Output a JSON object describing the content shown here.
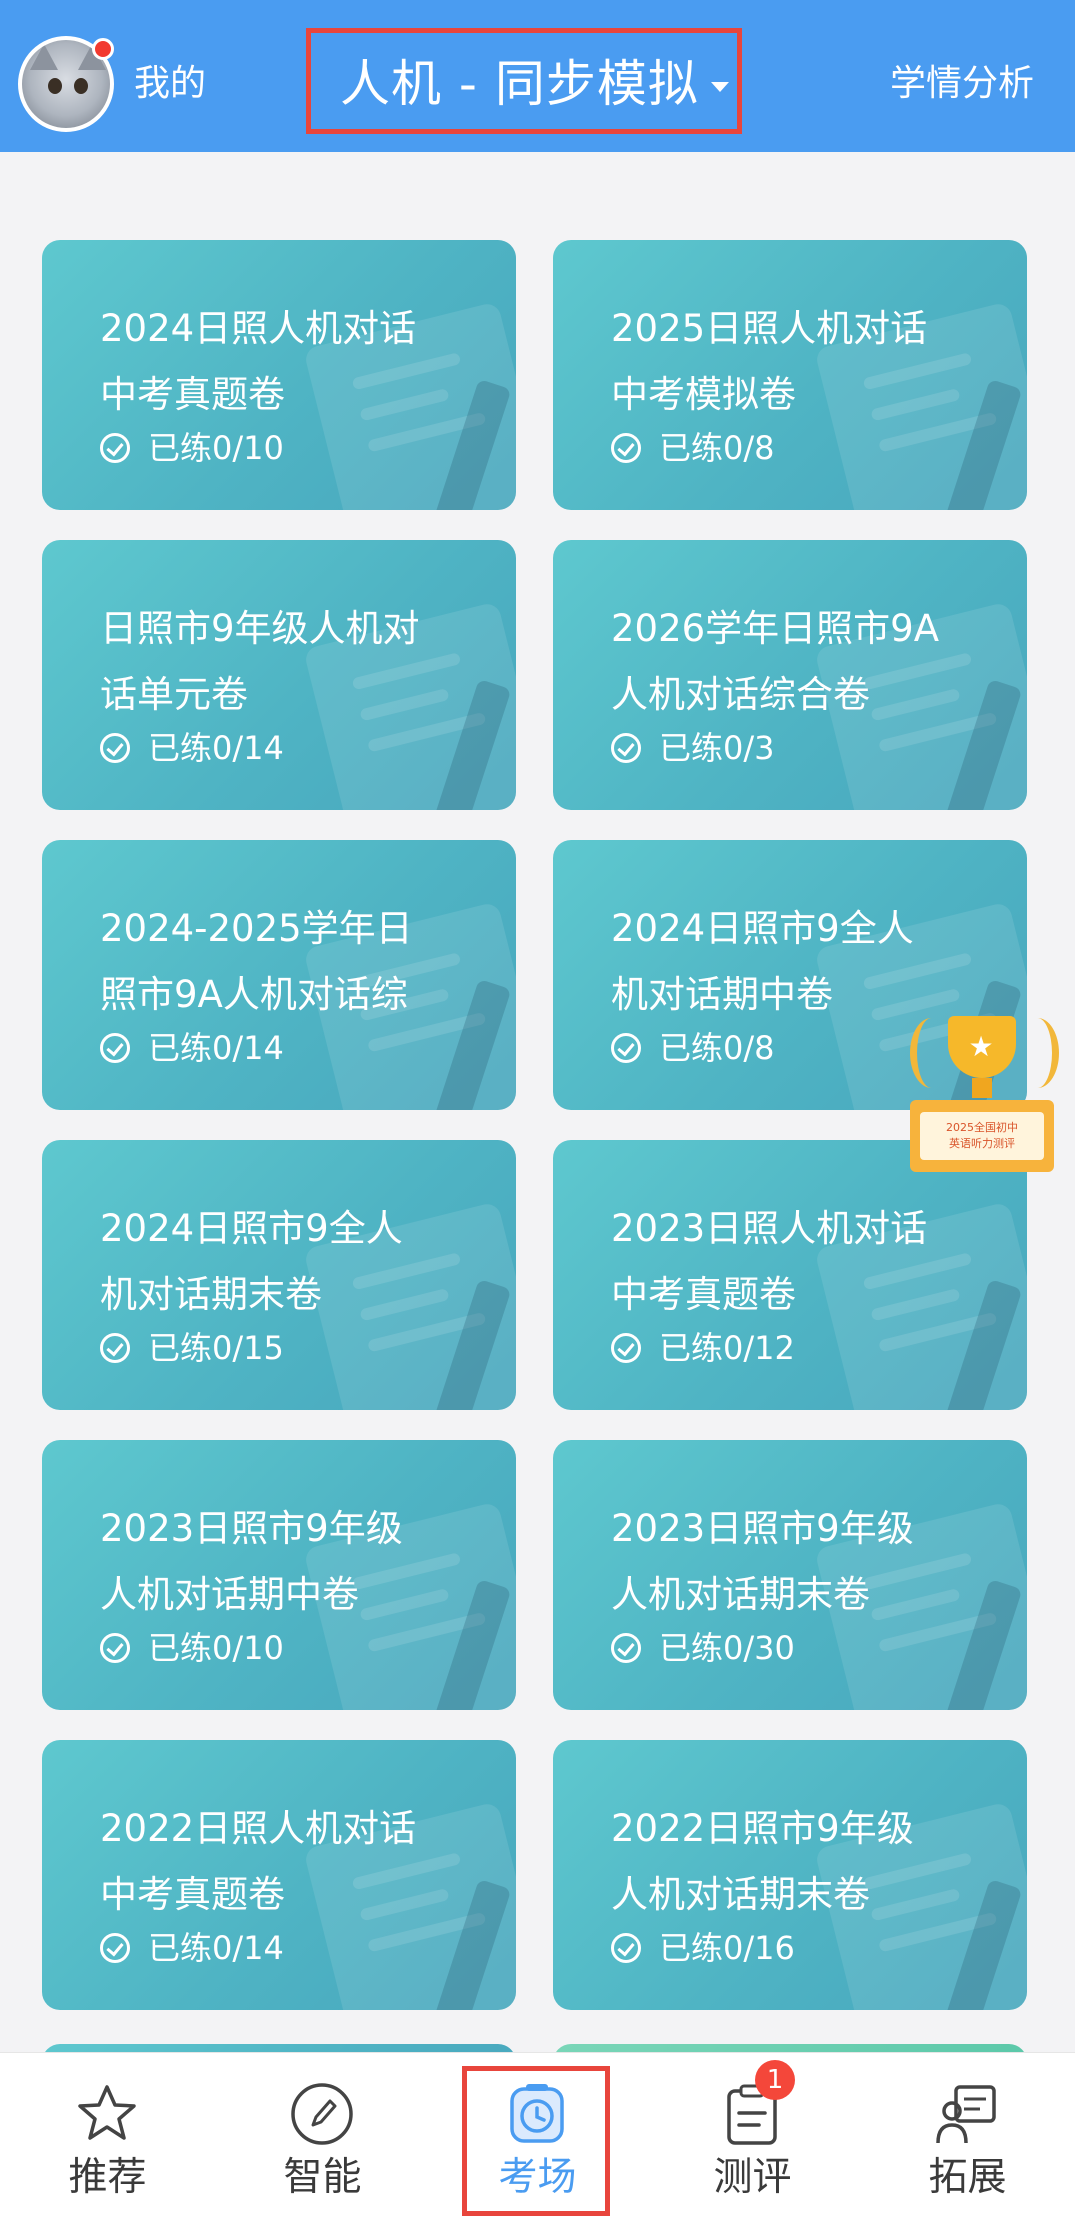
{
  "header": {
    "profile_label": "我的",
    "mode_title": "人机 - 同步模拟",
    "analysis_label": "学情分析"
  },
  "cards": [
    {
      "title": "2024日照人机对话\n中考真题卷",
      "status": "已练0/10"
    },
    {
      "title": "2025日照人机对话\n中考模拟卷",
      "status": "已练0/8"
    },
    {
      "title": "日照市9年级人机对\n话单元卷",
      "status": "已练0/14"
    },
    {
      "title": "2026学年日照市9A\n人机对话综合卷",
      "status": "已练0/3"
    },
    {
      "title": "2024-2025学年日\n照市9A人机对话综",
      "status": "已练0/14"
    },
    {
      "title": "2024日照市9全人\n机对话期中卷",
      "status": "已练0/8"
    },
    {
      "title": "2024日照市9全人\n机对话期末卷",
      "status": "已练0/15"
    },
    {
      "title": "2023日照人机对话\n中考真题卷",
      "status": "已练0/12"
    },
    {
      "title": "2023日照市9年级\n人机对话期中卷",
      "status": "已练0/10"
    },
    {
      "title": "2023日照市9年级\n人机对话期末卷",
      "status": "已练0/30"
    },
    {
      "title": "2022日照人机对话\n中考真题卷",
      "status": "已练0/14"
    },
    {
      "title": "2022日照市9年级\n人机对话期末卷",
      "status": "已练0/16"
    }
  ],
  "promo": {
    "trophy_text": "2025全国初中\n英语听力测评"
  },
  "tabbar": {
    "tabs": [
      {
        "label": "推荐",
        "icon": "star-icon"
      },
      {
        "label": "智能",
        "icon": "pencil-circle-icon"
      },
      {
        "label": "考场",
        "icon": "clock-icon"
      },
      {
        "label": "测评",
        "icon": "clipboard-icon"
      },
      {
        "label": "拓展",
        "icon": "person-board-icon"
      }
    ],
    "active_tab": "考场",
    "badge_count": "1"
  },
  "colors": {
    "header": "#4a9cf1",
    "card": "#52b8c7",
    "active": "#4a9cf1",
    "highlight_box": "#e8453c"
  }
}
